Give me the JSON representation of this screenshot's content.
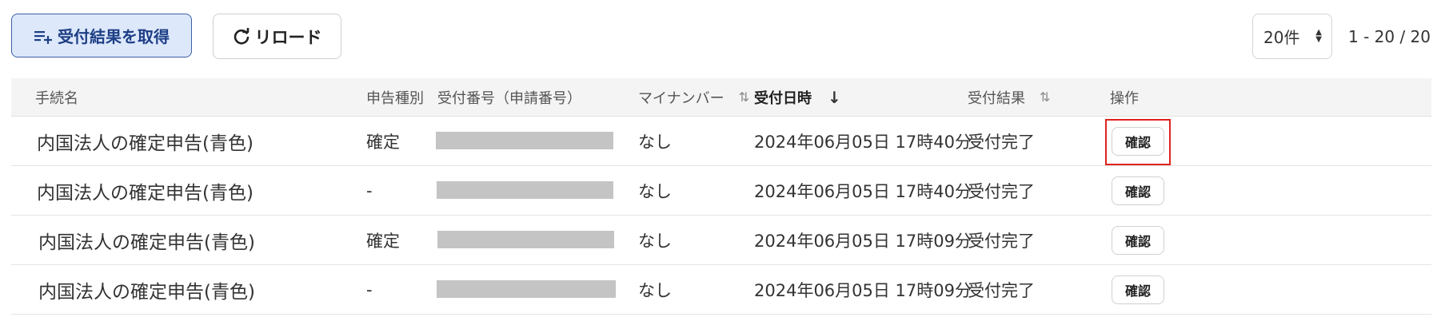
{
  "toolbar": {
    "fetch_label": "受付結果を取得",
    "reload_label": "リロード",
    "page_size": "20件",
    "page_range": "1 - 20 / 20"
  },
  "columns": {
    "procedure": "手続名",
    "type": "申告種別",
    "receipt_no": "受付番号（申請番号）",
    "mynumber": "マイナンバー",
    "received_at": "受付日時",
    "result": "受付結果",
    "action": "操作"
  },
  "sort": {
    "received_at": "descending"
  },
  "rows": [
    {
      "procedure": "内国法人の確定申告(青色)",
      "type": "確定",
      "receipt_no_redacted": true,
      "mynumber": "なし",
      "received_at": "2024年06月05日 17時40分",
      "result": "受付完了",
      "action": "確認",
      "highlighted": true
    },
    {
      "procedure": "内国法人の確定申告(青色)",
      "type": "-",
      "receipt_no_redacted": true,
      "mynumber": "なし",
      "received_at": "2024年06月05日 17時40分",
      "result": "受付完了",
      "action": "確認",
      "highlighted": false
    },
    {
      "procedure": "内国法人の確定申告(青色)",
      "type": "確定",
      "receipt_no_redacted": true,
      "mynumber": "なし",
      "received_at": "2024年06月05日 17時09分",
      "result": "受付完了",
      "action": "確認",
      "highlighted": false
    },
    {
      "procedure": "内国法人の確定申告(青色)",
      "type": "-",
      "receipt_no_redacted": true,
      "mynumber": "なし",
      "received_at": "2024年06月05日 17時09分",
      "result": "受付完了",
      "action": "確認",
      "highlighted": false
    }
  ],
  "colors": {
    "primary": "#1e3f86",
    "primary_bg": "#dde8fb",
    "highlight": "#e0221e",
    "redaction": "#c4c4c4"
  }
}
